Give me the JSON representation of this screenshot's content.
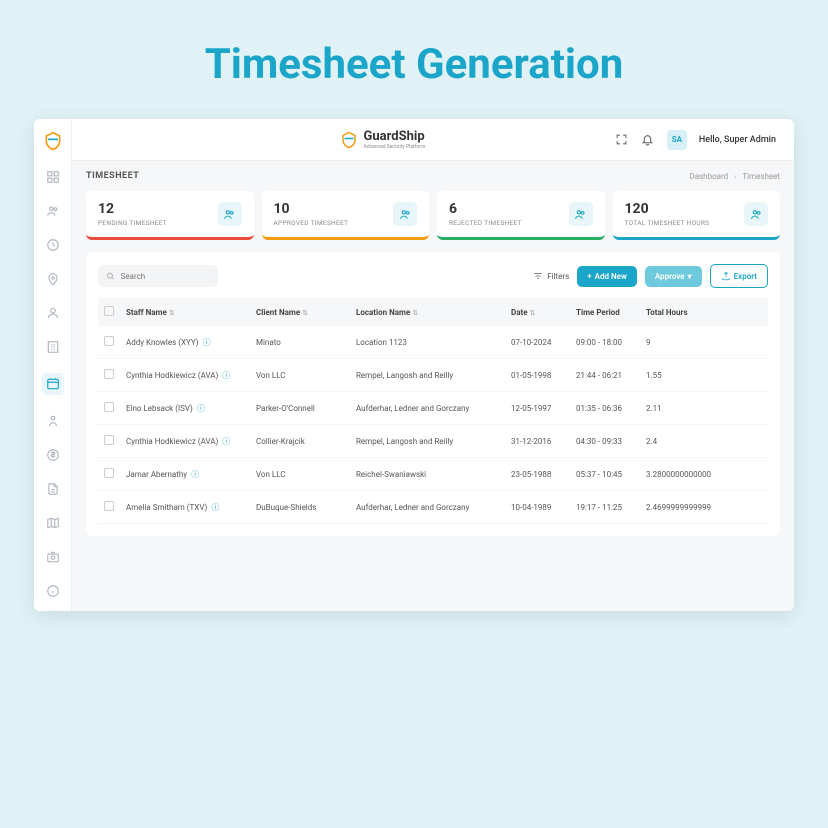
{
  "hero": "Timesheet Generation",
  "brand": {
    "name": "GuardShip",
    "tagline": "Advanced Security Platform"
  },
  "top": {
    "avatar": "SA",
    "greeting": "Hello, Super Admin"
  },
  "page": {
    "title": "TIMESHEET",
    "crumb1": "Dashboard",
    "crumb2": "Timesheet"
  },
  "stats": [
    {
      "value": "12",
      "label": "PENDING TIMESHEET"
    },
    {
      "value": "10",
      "label": "APPROVED TIMESHEET"
    },
    {
      "value": "6",
      "label": "REJECTED TIMESHEET"
    },
    {
      "value": "120",
      "label": "TOTAL TIMESHEET HOURS"
    }
  ],
  "toolbar": {
    "search_placeholder": "Search",
    "filters": "Filters",
    "add": "Add New",
    "approve": "Approve",
    "export": "Export"
  },
  "columns": {
    "staff": "Staff Name",
    "client": "Client Name",
    "location": "Location Name",
    "date": "Date",
    "period": "Time Period",
    "hours": "Total Hours"
  },
  "rows": [
    {
      "staff": "Addy Knowles (XYY)",
      "client": "Minato",
      "location": "Location 1123",
      "date": "07-10-2024",
      "period": "09:00 - 18:00",
      "hours": "9"
    },
    {
      "staff": "Cynthia Hodkiewicz (AVA)",
      "client": "Von LLC",
      "location": "Rempel, Langosh and Reilly",
      "date": "01-05-1998",
      "period": "21:44 - 06:21",
      "hours": "1.55"
    },
    {
      "staff": "Eino Lebsack (ISV)",
      "client": "Parker-O'Connell",
      "location": "Aufderhar, Ledner and Gorczany",
      "date": "12-05-1997",
      "period": "01:35 - 06:36",
      "hours": "2.11"
    },
    {
      "staff": "Cynthia Hodkiewicz (AVA)",
      "client": "Collier-Krajcik",
      "location": "Rempel, Langosh and Reilly",
      "date": "31-12-2016",
      "period": "04:30 - 09:33",
      "hours": "2.4"
    },
    {
      "staff": "Jamar Abernathy",
      "client": "Von LLC",
      "location": "Reichel-Swaniawski",
      "date": "23-05-1988",
      "period": "05:37 - 10:45",
      "hours": "3.2800000000000"
    },
    {
      "staff": "Amelia Smitham (TXV)",
      "client": "DuBuque-Shields",
      "location": "Aufderhar, Ledner and Gorczany",
      "date": "10-04-1989",
      "period": "19:17 - 11:25",
      "hours": "2.4699999999999"
    }
  ]
}
